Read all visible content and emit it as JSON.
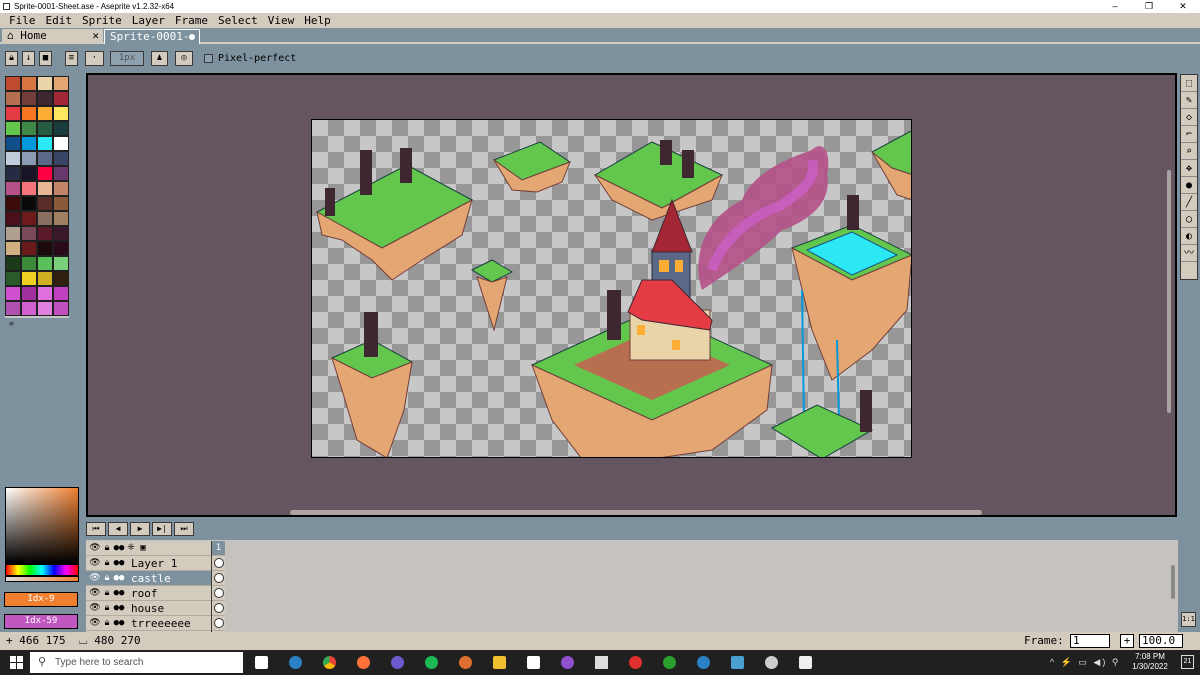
{
  "window": {
    "title": "Sprite-0001-Sheet.ase - Aseprite v1.2.32-x64",
    "minimize": "–",
    "maximize": "❐",
    "close": "✕"
  },
  "menu": [
    "File",
    "Edit",
    "Sprite",
    "Layer",
    "Frame",
    "Select",
    "View",
    "Help"
  ],
  "tabs": {
    "home": "Home",
    "home_close": "✕",
    "file": "Sprite-0001-She"
  },
  "toolbar": {
    "pixel_perfect": "Pixel-perfect",
    "brush_size": "1px"
  },
  "palette": [
    "#be4a2f",
    "#d77643",
    "#ead4aa",
    "#e4a672",
    "#b86f50",
    "#733e39",
    "#3e2731",
    "#a22633",
    "#e43b44",
    "#f77622",
    "#feae34",
    "#fee761",
    "#63c74d",
    "#3e8948",
    "#265c42",
    "#193c3e",
    "#124e89",
    "#0099db",
    "#2ce8f5",
    "#ffffff",
    "#c0cbdc",
    "#8b9bb4",
    "#5a6988",
    "#3a4466",
    "#262b44",
    "#181425",
    "#ff0044",
    "#68386c",
    "#b55088",
    "#f6757a",
    "#e8b796",
    "#c28569",
    "#3b0a0a",
    "#0a0a0a",
    "#5a2d28",
    "#8a5a3a",
    "#4a0f1a",
    "#6e1a1a",
    "#8a7060",
    "#a08060",
    "#b0a090",
    "#7a4a5a",
    "#5a1a2a",
    "#3a1a2a",
    "#d0b080",
    "#6a1a1a",
    "#1a0a0a",
    "#2a0a1a",
    "#1a3a1a",
    "#3a8a3a",
    "#5ac05a",
    "#7ad07a",
    "#2a5a2a",
    "#f0d020",
    "#d0b020",
    "#302010",
    "#d050d0",
    "#a030a0",
    "#e070e0",
    "#c040c0",
    "#b050b0",
    "#d060d0",
    "#e080e0",
    "#c050c0"
  ],
  "colors": {
    "foreground": "#f08030",
    "foreground_label": "Idx-9",
    "background": "#c058c0",
    "background_label": "Idx-59"
  },
  "anim_controls": [
    "⏮",
    "◀",
    "▶",
    "▶|",
    "⏭"
  ],
  "layers": [
    {
      "name": "Layer 1",
      "selected": false
    },
    {
      "name": "castle",
      "selected": true
    },
    {
      "name": "roof",
      "selected": false
    },
    {
      "name": "house",
      "selected": false
    },
    {
      "name": "trreeeeee",
      "selected": false
    }
  ],
  "frame_header": "1",
  "status": {
    "cursor_pos": "+ 466 175",
    "sprite_size": "480 270",
    "frame_label": "Frame:",
    "frame_value": "1",
    "zoom": "100.0",
    "zoom_btn": "+"
  },
  "tools": [
    "marquee-icon",
    "pencil-icon",
    "eraser-icon",
    "eyedropper-icon",
    "zoom-icon",
    "move-icon",
    "bucket-icon",
    "line-icon",
    "ellipse-icon",
    "contour-icon",
    "blur-icon"
  ],
  "taskbar": {
    "search_placeholder": "Type here to search",
    "time": "7:08 PM",
    "date": "1/30/2022",
    "tray": "^ ⚡ ▭ ◀) ⚲",
    "notif": "21"
  }
}
